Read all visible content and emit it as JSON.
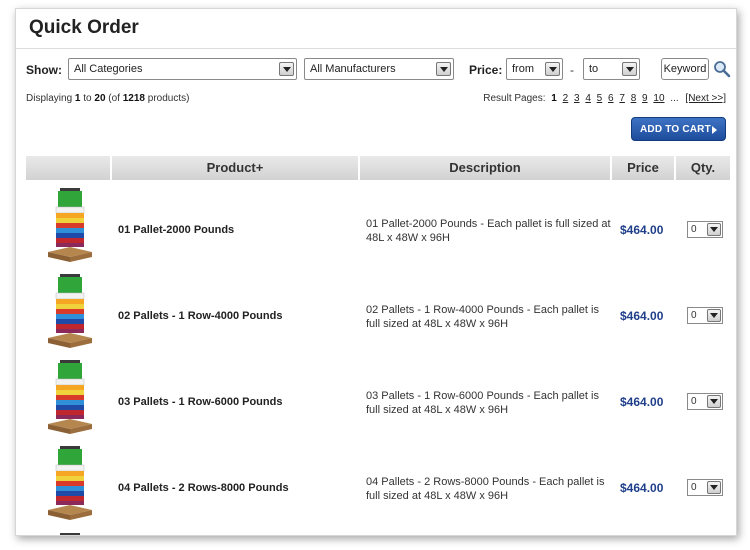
{
  "page": {
    "title": "Quick Order"
  },
  "filters": {
    "show_label": "Show:",
    "category": {
      "selected": "All Categories"
    },
    "manufacturer": {
      "selected": "All Manufacturers"
    },
    "price_label": "Price:",
    "price_from": {
      "selected": "from"
    },
    "price_separator": "-",
    "price_to": {
      "selected": "to"
    },
    "keyword_label": "Keyword",
    "search_icon": "magnifier-icon"
  },
  "results": {
    "prefix": "Displaying",
    "start": "1",
    "to_word": "to",
    "end": "20",
    "of_open": "(of",
    "total": "1218",
    "of_close": "products)",
    "pages_label": "Result Pages:",
    "current_page": "1",
    "pages": [
      "2",
      "3",
      "4",
      "5",
      "6",
      "7",
      "8",
      "9",
      "10"
    ],
    "ellipsis": "...",
    "next_label": "[Next >>]"
  },
  "cart": {
    "add_label": "ADD TO CART",
    "arrow_icon": "triangle-right-icon"
  },
  "table": {
    "headers": {
      "image": "",
      "product": "Product+",
      "description": "Description",
      "price": "Price",
      "qty": "Qty."
    },
    "rows": [
      {
        "name": "01 Pallet-2000 Pounds",
        "description": "01 Pallet-2000 Pounds - Each pallet is full sized at 48L x 48W x 96H",
        "price": "$464.00",
        "qty": "0"
      },
      {
        "name": "02 Pallets - 1 Row-4000 Pounds",
        "description": "02 Pallets - 1 Row-4000 Pounds - Each pallet is full sized at 48L x 48W x 96H",
        "price": "$464.00",
        "qty": "0"
      },
      {
        "name": "03 Pallets - 1 Row-6000 Pounds",
        "description": "03 Pallets - 1 Row-6000 Pounds - Each pallet is full sized at 48L x 48W x 96H",
        "price": "$464.00",
        "qty": "0"
      },
      {
        "name": "04 Pallets - 2 Rows-8000 Pounds",
        "description": "04 Pallets - 2 Rows-8000 Pounds - Each pallet is full sized at 48L x 48W x 96H",
        "price": "$464.00",
        "qty": "0"
      }
    ]
  },
  "colors": {
    "price": "#1f3f8a",
    "button": "#2a5fb0"
  }
}
